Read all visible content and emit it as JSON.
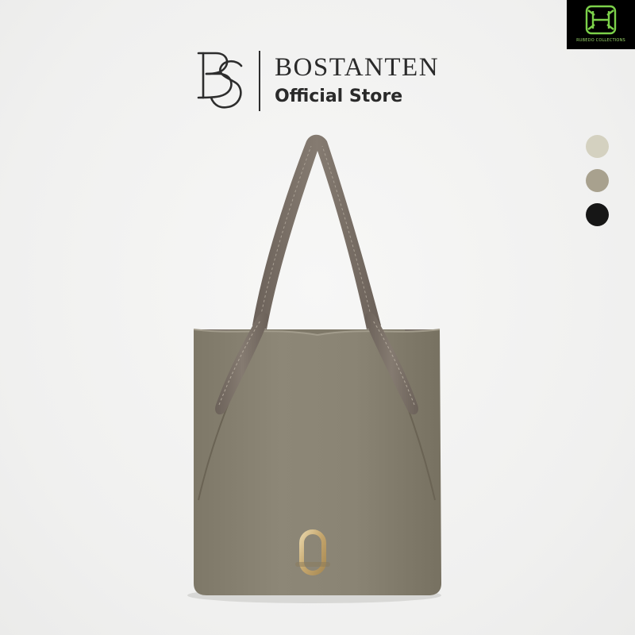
{
  "brand": {
    "name": "BOSTANTEN",
    "subtitle": "Official Store"
  },
  "badge": {
    "text": "RUBEDO COLLECTIONS",
    "icon": "rubedo-logo-icon",
    "color": "#9bd86a"
  },
  "product": {
    "image": "taupe-leather-tote-bag",
    "color": "#8a8474",
    "hardware_color": "#c9ac77"
  },
  "color_options": [
    {
      "name": "beige",
      "hex": "#d4d1c0"
    },
    {
      "name": "taupe",
      "hex": "#a8a18e"
    },
    {
      "name": "black",
      "hex": "#161616"
    }
  ]
}
